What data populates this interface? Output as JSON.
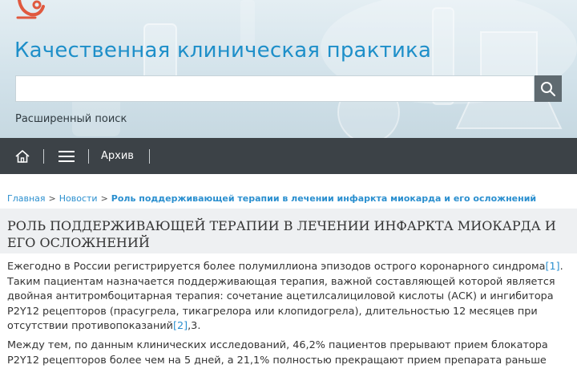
{
  "header": {
    "site_title": "Качественная клиническая практика",
    "search_placeholder": "",
    "advanced_search": "Расширенный поиск"
  },
  "nav": {
    "archive_label": "Архив"
  },
  "breadcrumb": {
    "home": "Главная",
    "separator": ">",
    "news": "Новости",
    "current": "Роль поддерживающей терапии в лечении инфаркта миокарда и его осложнений"
  },
  "article": {
    "title": "РОЛЬ ПОДДЕРЖИВАЮЩЕЙ ТЕРАПИИ В ЛЕЧЕНИИ ИНФАРКТА МИОКАРДА И ЕГО ОСЛОЖНЕНИЙ",
    "p1_a": "Ежегодно в России регистрируется более полумиллиона эпизодов острого коронарного синдрома",
    "ref1": "[1]",
    "p1_b": ". Таким пациентам назначается поддерживающая терапия, важной составляющей которой является двойная антитромбоцитарная терапия: сочетание ацетилсалициловой кислоты (АСК) и ингибитора P2Y12 рецепторов (прасугрела, тикагрелора или клопидогрела), длительностью 12 месяцев при отсутствии противопоказаний",
    "ref2": "[2]",
    "p1_c": ",3.",
    "p2": "Между тем, по данным клинических исследований, 46,2% пациентов прерывают прием блокатора P2Y12 рецепторов более чем на 5 дней, а 21,1% полностью прекращают прием препарата раньше"
  },
  "icons": {
    "logo": "microscope-icon",
    "search": "search-icon",
    "home": "home-icon",
    "menu": "menu-icon"
  },
  "colors": {
    "accent": "#2a8fcf",
    "title_blue": "#1e8fc9",
    "navbar": "#3c4247",
    "logo_red": "#e0593f"
  }
}
